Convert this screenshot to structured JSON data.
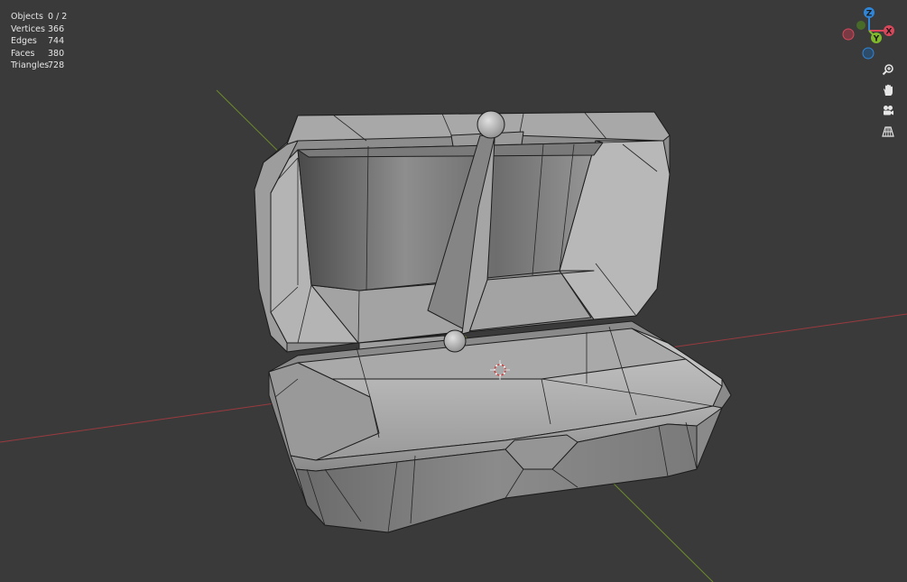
{
  "stats": [
    {
      "label": "Objects",
      "value": "0 / 2"
    },
    {
      "label": "Vertices",
      "value": "366"
    },
    {
      "label": "Edges",
      "value": "744"
    },
    {
      "label": "Faces",
      "value": "380"
    },
    {
      "label": "Triangles",
      "value": "728"
    }
  ],
  "gizmo": {
    "x_label": "X",
    "y_label": "Y",
    "z_label": "Z",
    "x_color": "#d9475b",
    "y_color": "#7fb82c",
    "z_color": "#2f86d9"
  },
  "nav_tools": [
    {
      "icon": "zoom-icon"
    },
    {
      "icon": "hand-pan-icon"
    },
    {
      "icon": "camera-icon"
    },
    {
      "icon": "grid-perspective-icon"
    }
  ],
  "colors": {
    "background": "#3a3a3a",
    "x_axis_line": "#9a3a3f",
    "y_axis_line": "#6c8a2c"
  }
}
